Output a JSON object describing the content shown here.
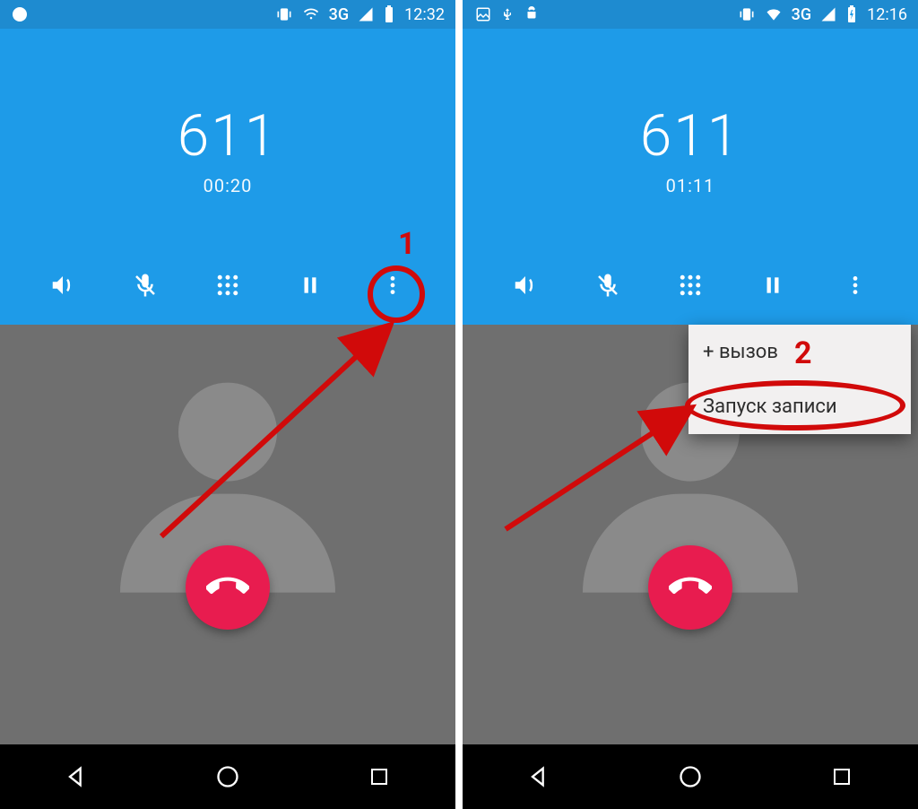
{
  "left": {
    "status": {
      "time": "12:32",
      "network": "3G"
    },
    "call": {
      "number": "611",
      "timer": "00:20"
    },
    "annotation_label": "1"
  },
  "right": {
    "status": {
      "time": "12:16",
      "network": "3G"
    },
    "call": {
      "number": "611",
      "timer": "01:11"
    },
    "menu": {
      "add_call": "+ вызов",
      "start_record": "Запуск записи"
    },
    "annotation_label": "2"
  }
}
